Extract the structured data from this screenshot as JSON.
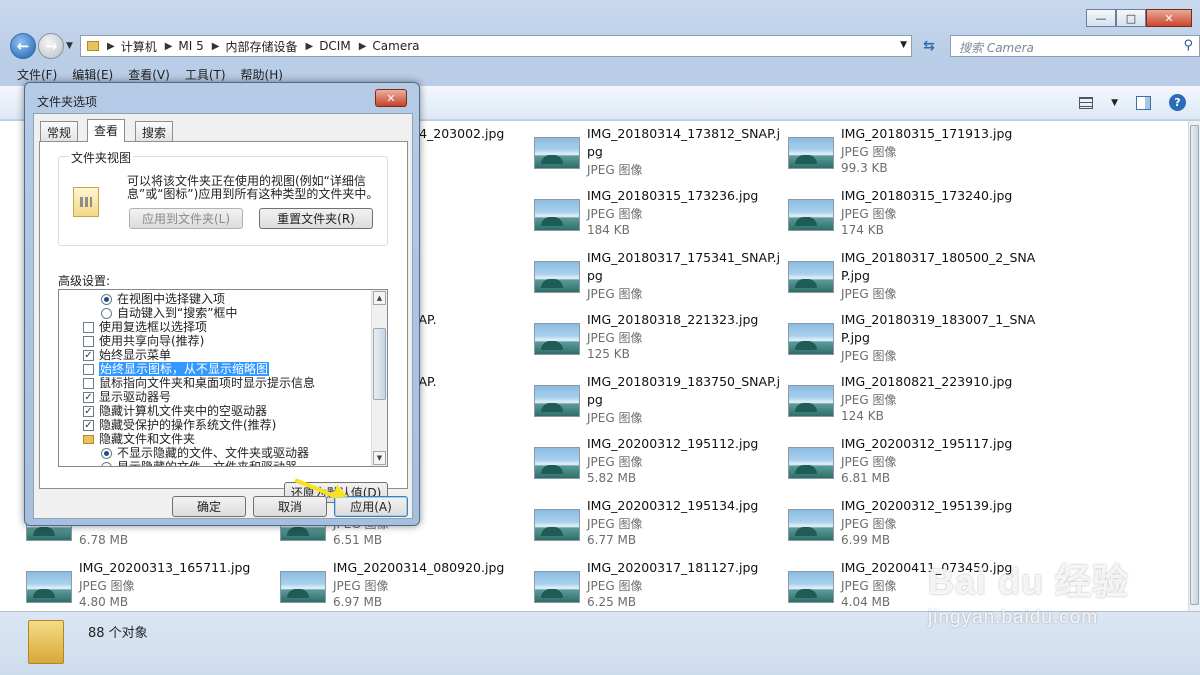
{
  "window": {
    "caption_buttons": [
      "minimize",
      "maximize",
      "close"
    ]
  },
  "nav": {
    "breadcrumbs": [
      "计算机",
      "MI 5",
      "内部存储设备",
      "DCIM",
      "Camera"
    ],
    "search_placeholder": "搜索 Camera"
  },
  "menu": [
    "文件(F)",
    "编辑(E)",
    "查看(V)",
    "工具(T)",
    "帮助(H)"
  ],
  "files": [
    {
      "name": "IMG_20180314_203002.jpg",
      "type": "",
      "size": ""
    },
    {
      "name": "IMG_20180314_173812_SNAP.jpg",
      "type": "JPEG 图像",
      "size": ""
    },
    {
      "name": "IMG_20180315_171913.jpg",
      "type": "JPEG 图像",
      "size": "99.3 KB"
    },
    {
      "name": "173231.jpg",
      "type": "",
      "size": ""
    },
    {
      "name": "IMG_20180315_173236.jpg",
      "type": "JPEG 图像",
      "size": "184 KB"
    },
    {
      "name": "IMG_20180315_173240.jpg",
      "type": "JPEG 图像",
      "size": "174 KB"
    },
    {
      "name": "121907.jpg",
      "type": "",
      "size": ""
    },
    {
      "name": "IMG_20180317_175341_SNAP.jpg",
      "type": "JPEG 图像",
      "size": ""
    },
    {
      "name": "IMG_20180317_180500_2_SNAP.jpg",
      "type": "JPEG 图像",
      "size": ""
    },
    {
      "name": "210035_2_SNAP.",
      "type": "",
      "size": ""
    },
    {
      "name": "IMG_20180318_221323.jpg",
      "type": "JPEG 图像",
      "size": "125 KB"
    },
    {
      "name": "IMG_20180319_183007_1_SNAP.jpg",
      "type": "JPEG 图像",
      "size": ""
    },
    {
      "name": "183750_1_SNAP.",
      "type": "",
      "size": ""
    },
    {
      "name": "IMG_20180319_183750_SNAP.jpg",
      "type": "JPEG 图像",
      "size": ""
    },
    {
      "name": "IMG_20180821_223910.jpg",
      "type": "JPEG 图像",
      "size": "124 KB"
    },
    {
      "name": "184918.jpg",
      "type": "",
      "size": ""
    },
    {
      "name": "IMG_20200312_195112.jpg",
      "type": "JPEG 图像",
      "size": "5.82 MB"
    },
    {
      "name": "IMG_20200312_195117.jpg",
      "type": "JPEG 图像",
      "size": "6.81 MB"
    },
    {
      "name": "JPEG 图像",
      "type": "",
      "size": "6.78 MB"
    },
    {
      "name": "195129.jpg",
      "type": "JPEG 图像",
      "size": "6.51 MB"
    },
    {
      "name": "IMG_20200312_195134.jpg",
      "type": "JPEG 图像",
      "size": "6.77 MB"
    },
    {
      "name": "IMG_20200312_195139.jpg",
      "type": "JPEG 图像",
      "size": "6.99 MB"
    },
    {
      "name": "IMG_20200313_165711.jpg",
      "type": "JPEG 图像",
      "size": "4.80 MB"
    },
    {
      "name": "IMG_20200314_080920.jpg",
      "type": "JPEG 图像",
      "size": "6.97 MB"
    },
    {
      "name": "IMG_20200317_181127.jpg",
      "type": "JPEG 图像",
      "size": "6.25 MB"
    },
    {
      "name": "IMG_20200411_073450.jpg",
      "type": "JPEG 图像",
      "size": "4.04 MB"
    }
  ],
  "status": {
    "count_text": "88 个对象"
  },
  "watermark": {
    "line1": "Bai du 经验",
    "line2": "jingyan.baidu.com"
  },
  "dialog": {
    "title": "文件夹选项",
    "close_glyph": "✕",
    "tabs": [
      "常规",
      "查看",
      "搜索"
    ],
    "group_title": "文件夹视图",
    "group_desc": "可以将该文件夹正在使用的视图(例如“详细信息”或“图标”)应用到所有这种类型的文件夹中。",
    "apply_to_folders": "应用到文件夹(L)",
    "reset_folders": "重置文件夹(R)",
    "advanced_label": "高级设置:",
    "options": [
      {
        "kind": "radio",
        "on": true,
        "indent": 2,
        "text": "在视图中选择键入项"
      },
      {
        "kind": "radio",
        "on": false,
        "indent": 2,
        "text": "自动键入到“搜索”框中"
      },
      {
        "kind": "check",
        "on": false,
        "indent": 1,
        "text": "使用复选框以选择项"
      },
      {
        "kind": "check",
        "on": false,
        "indent": 1,
        "text": "使用共享向导(推荐)"
      },
      {
        "kind": "check",
        "on": true,
        "indent": 1,
        "text": "始终显示菜单"
      },
      {
        "kind": "check",
        "on": false,
        "indent": 1,
        "text": "始终显示图标，从不显示缩略图",
        "selected": true
      },
      {
        "kind": "check",
        "on": false,
        "indent": 1,
        "text": "鼠标指向文件夹和桌面项时显示提示信息"
      },
      {
        "kind": "check",
        "on": true,
        "indent": 1,
        "text": "显示驱动器号"
      },
      {
        "kind": "check",
        "on": true,
        "indent": 1,
        "text": "隐藏计算机文件夹中的空驱动器"
      },
      {
        "kind": "check",
        "on": true,
        "indent": 1,
        "text": "隐藏受保护的操作系统文件(推荐)"
      },
      {
        "kind": "folder",
        "on": false,
        "indent": 1,
        "text": "隐藏文件和文件夹"
      },
      {
        "kind": "radio",
        "on": true,
        "indent": 2,
        "text": "不显示隐藏的文件、文件夹或驱动器"
      },
      {
        "kind": "radio",
        "on": false,
        "indent": 2,
        "text": "显示隐藏的文件、文件夹和驱动器"
      }
    ],
    "restore_defaults": "还原为默认值(D)",
    "ok": "确定",
    "cancel": "取消",
    "apply": "应用(A)"
  }
}
